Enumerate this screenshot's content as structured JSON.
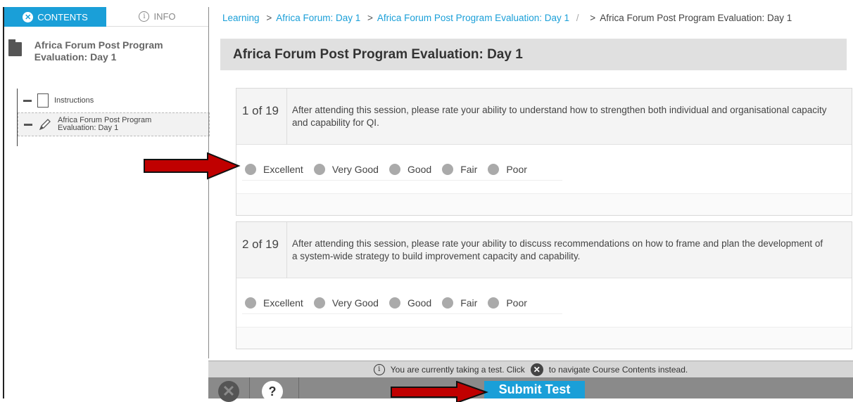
{
  "sidebar": {
    "tab_contents": "CONTENTS",
    "tab_info": "INFO",
    "course_title": "Africa Forum Post Program Evaluation: Day 1",
    "items": [
      {
        "label": "Instructions"
      },
      {
        "label": "Africa Forum Post Program Evaluation: Day 1"
      }
    ]
  },
  "breadcrumb": {
    "root": "Learning",
    "level1": "Africa Forum: Day 1",
    "level2": "Africa Forum Post Program Evaluation: Day 1",
    "current": "Africa Forum Post Program Evaluation: Day 1",
    "sep": ">",
    "slash": "/"
  },
  "main": {
    "title": "Africa Forum Post Program Evaluation: Day 1",
    "questions": [
      {
        "number": "1 of 19",
        "text": "After attending this session, please rate your ability to understand how to strengthen both individual and organisational capacity and capability for QI.",
        "options": [
          "Excellent",
          "Very Good",
          "Good",
          "Fair",
          "Poor"
        ]
      },
      {
        "number": "2 of 19",
        "text": "After attending this session, please rate your ability to discuss recommendations on how to frame and plan the development of a system-wide strategy to build improvement capacity and capability.",
        "options": [
          "Excellent",
          "Very Good",
          "Good",
          "Fair",
          "Poor"
        ]
      }
    ]
  },
  "notice": {
    "prefix": "You are currently taking a test. Click",
    "suffix": "to navigate Course Contents instead."
  },
  "toolbar": {
    "help_label": "?",
    "submit_label": "Submit Test"
  },
  "colors": {
    "accent": "#1a9fd8",
    "arrow": "#c00000"
  }
}
